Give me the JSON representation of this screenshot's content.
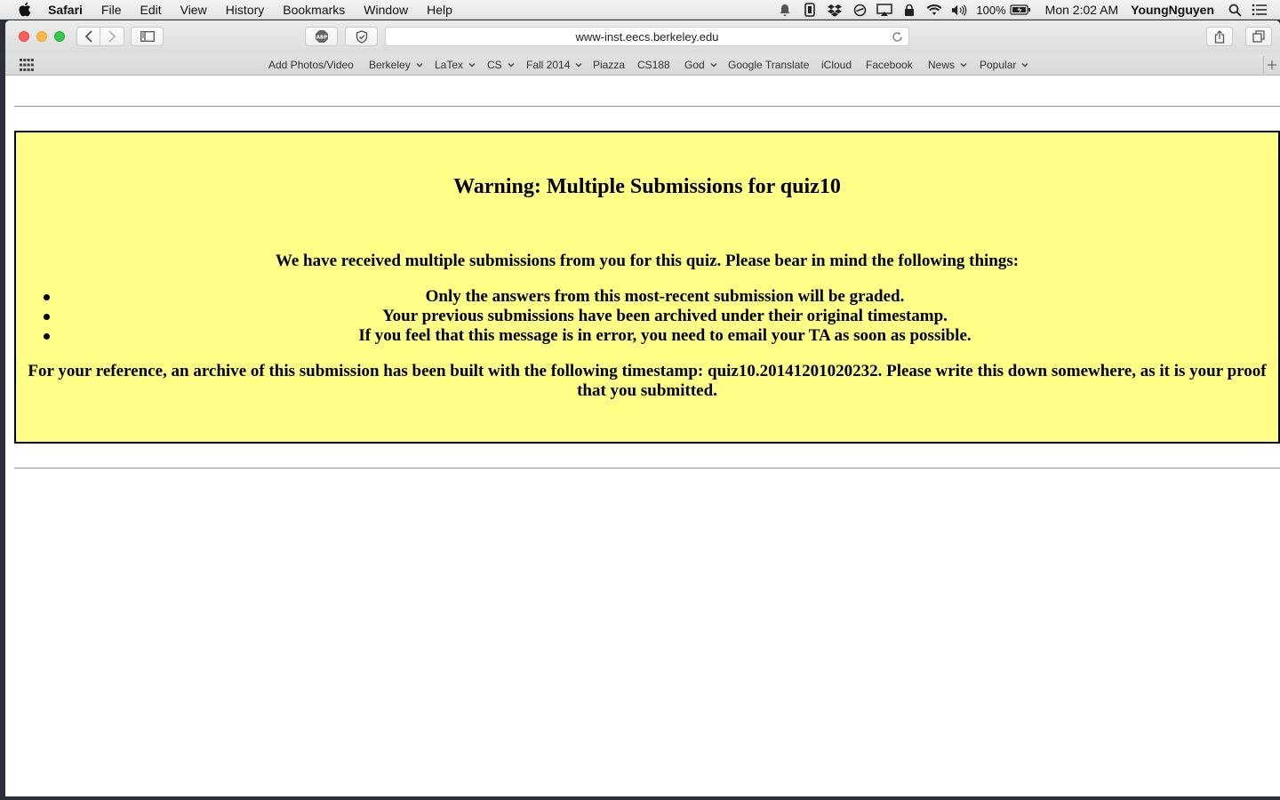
{
  "menubar": {
    "app_name": "Safari",
    "items": [
      "File",
      "Edit",
      "View",
      "History",
      "Bookmarks",
      "Window",
      "Help"
    ],
    "battery": "100%",
    "clock": "Mon 2:02 AM",
    "user": "YoungNguyen",
    "status_icons": [
      "notification-bell-icon",
      "device-icon",
      "dropbox-icon",
      "sync-icon",
      "airplay-icon",
      "lock-icon",
      "wifi-icon",
      "volume-icon",
      "battery-icon",
      "spotlight-search-icon",
      "notification-center-icon"
    ]
  },
  "browser": {
    "url": "www-inst.eecs.berkeley.edu",
    "favorites": [
      {
        "label": "Add Photos/Video",
        "menu": false
      },
      {
        "label": "Berkeley",
        "menu": true
      },
      {
        "label": "LaTex",
        "menu": true
      },
      {
        "label": "CS",
        "menu": true
      },
      {
        "label": "Fall 2014",
        "menu": true
      },
      {
        "label": "Piazza",
        "menu": false
      },
      {
        "label": "CS188",
        "menu": false
      },
      {
        "label": "God",
        "menu": true
      },
      {
        "label": "Google Translate",
        "menu": false
      },
      {
        "label": "iCloud",
        "menu": false
      },
      {
        "label": "Facebook",
        "menu": false
      },
      {
        "label": "News",
        "menu": true
      },
      {
        "label": "Popular",
        "menu": true
      }
    ]
  },
  "page": {
    "title": "Warning: Multiple Submissions for quiz10",
    "intro": "We have received multiple submissions from you for this quiz. Please bear in mind the following things:",
    "bullets": [
      "Only the answers from this most-recent submission will be graded.",
      "Your previous submissions have been archived under their original timestamp.",
      "If you feel that this message is in error, you need to email your TA as soon as possible."
    ],
    "reference": "For your reference, an archive of this submission has been built with the following timestamp: quiz10.20141201020232. Please write this down somewhere, as it is your proof that you submitted."
  },
  "colors": {
    "warning_background": "#ffff88",
    "warning_border": "#000000"
  }
}
